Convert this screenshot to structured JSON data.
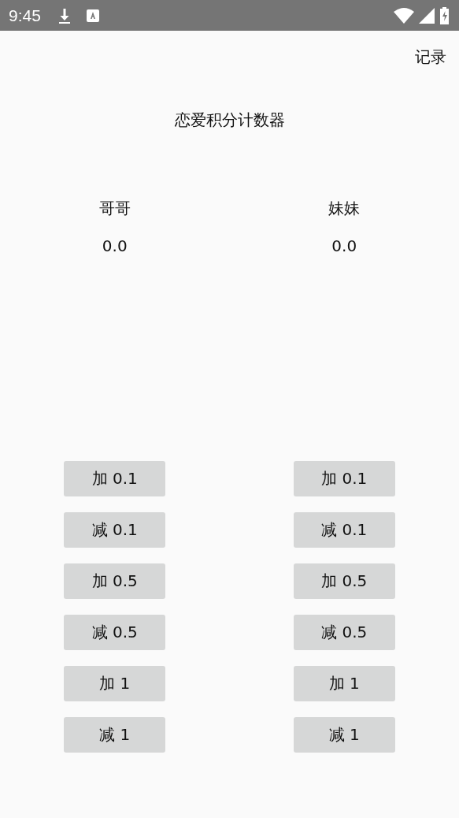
{
  "status_bar": {
    "time": "9:45"
  },
  "record_button": "记录",
  "title": "恋爱积分计数器",
  "players": [
    {
      "name": "哥哥",
      "score": "0.0",
      "buttons": [
        "加 0.1",
        "减 0.1",
        "加 0.5",
        "减 0.5",
        "加 1",
        "减 1"
      ]
    },
    {
      "name": "妹妹",
      "score": "0.0",
      "buttons": [
        "加 0.1",
        "减 0.1",
        "加 0.5",
        "减 0.5",
        "加 1",
        "减 1"
      ]
    }
  ]
}
